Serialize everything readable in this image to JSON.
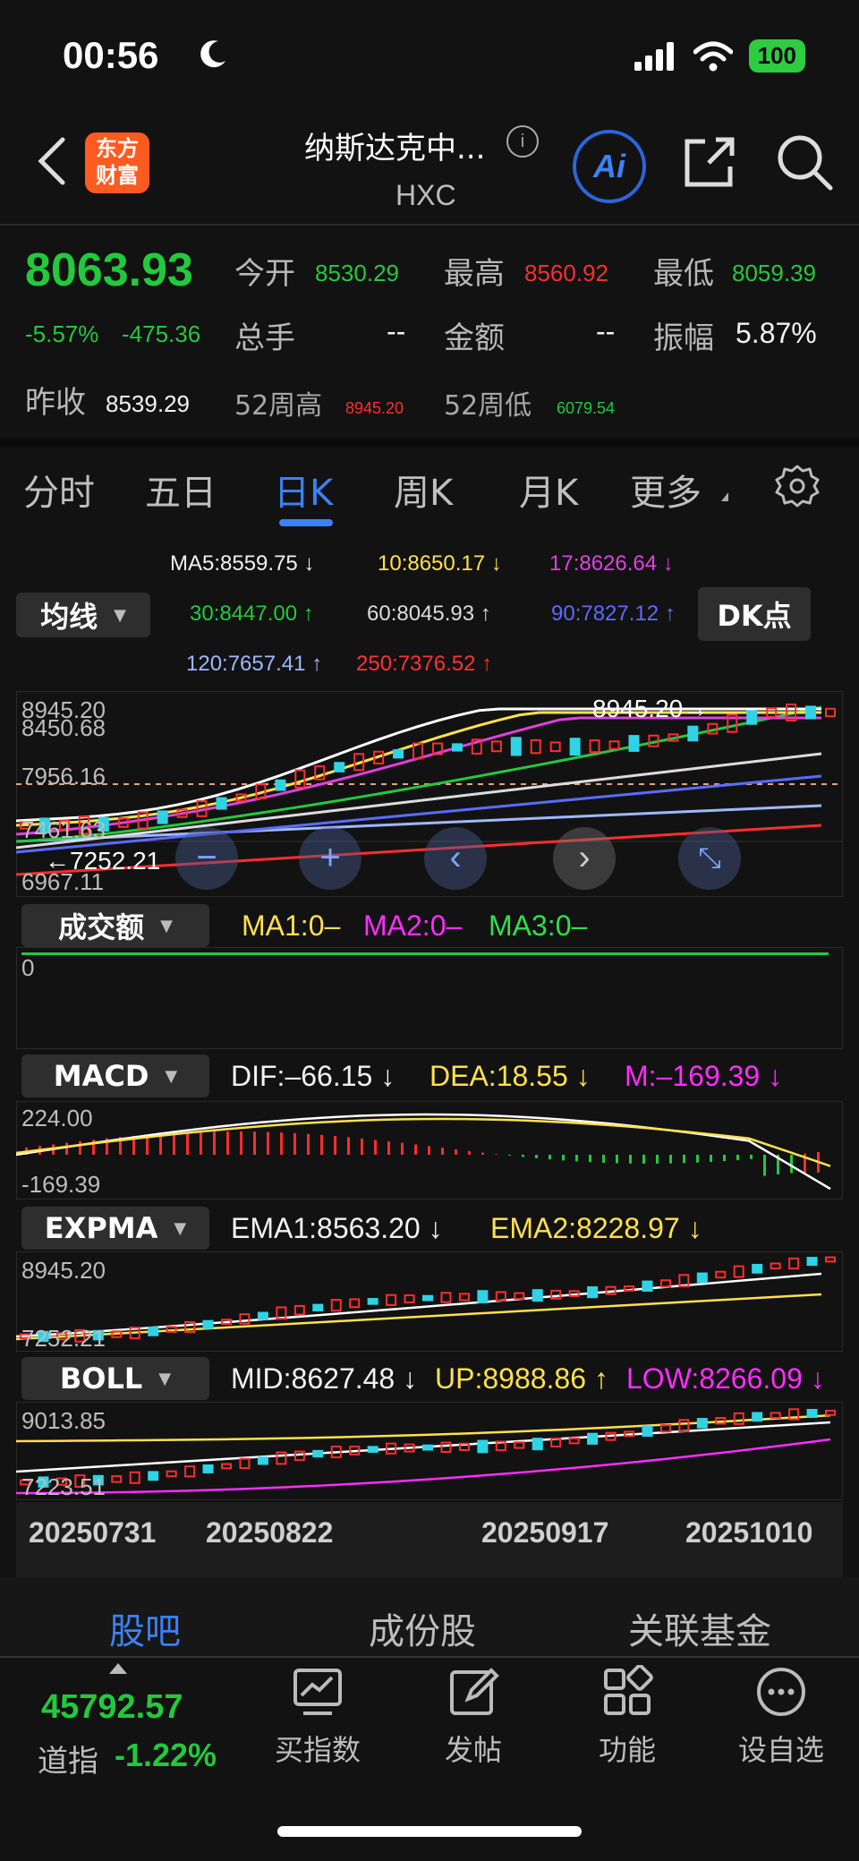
{
  "status": {
    "time": "00:56",
    "battery": "100"
  },
  "header": {
    "title": "纳斯达克中...",
    "code": "HXC",
    "logo_text": "东方\n财富",
    "ai_label": "Ai"
  },
  "quote": {
    "price": "8063.93",
    "change_pct": "-5.57%",
    "change": "-475.36",
    "open_label": "今开",
    "open": "8530.29",
    "high_label": "最高",
    "high": "8560.92",
    "low_label": "最低",
    "low": "8059.39",
    "volume_label": "总手",
    "volume": "--",
    "amount_label": "金额",
    "amount": "--",
    "amplitude_label": "振幅",
    "amplitude": "5.87%",
    "prev_label": "昨收",
    "prev": "8539.29",
    "w52h_label": "52周高",
    "w52h": "8945.20",
    "w52l_label": "52周低",
    "w52l": "6079.54"
  },
  "tabs": [
    "分时",
    "五日",
    "日K",
    "周K",
    "月K",
    "更多"
  ],
  "ma": {
    "selector": "均线",
    "dk": "DK点",
    "ma5": "MA5:8559.75 ↓",
    "ma10": "10:8650.17 ↓",
    "ma17": "17:8626.64 ↓",
    "ma30": "30:8447.00 ↑",
    "ma60": "60:8045.93 ↑",
    "ma90": "90:7827.12 ↑",
    "ma120": "120:7657.41 ↑",
    "ma250": "250:7376.52 ↑"
  },
  "main_chart": {
    "labels": [
      "8945.20",
      "8450.68",
      "7956.16",
      "7461.63",
      "6967.11"
    ],
    "max_label": "8945.20",
    "min_label": "7252.21"
  },
  "volume_panel": {
    "selector": "成交额",
    "ma1": "MA1:0–",
    "ma2": "MA2:0–",
    "ma3": "MA3:0–",
    "zero": "0"
  },
  "macd_panel": {
    "selector": "MACD",
    "dif": "DIF:–66.15 ↓",
    "dea": "DEA:18.55 ↓",
    "m": "M:–169.39 ↓",
    "top": "224.00",
    "bottom": "-169.39"
  },
  "expma_panel": {
    "selector": "EXPMA",
    "ema1": "EMA1:8563.20 ↓",
    "ema2": "EMA2:8228.97 ↓",
    "top": "8945.20",
    "bottom": "7252.21"
  },
  "boll_panel": {
    "selector": "BOLL",
    "mid": "MID:8627.48 ↓",
    "up": "UP:8988.86 ↑",
    "low": "LOW:8266.09 ↓",
    "top": "9013.85",
    "bottom": "7223.51"
  },
  "dates": [
    "20250731",
    "20250822",
    "20250917",
    "20251010"
  ],
  "bottom_tabs": [
    "股吧",
    "成份股",
    "关联基金"
  ],
  "bottom_nav": {
    "dow_value": "45792.57",
    "dow_label": "道指",
    "dow_change": "-1.22%",
    "items": [
      "买指数",
      "发帖",
      "功能",
      "设自选"
    ]
  },
  "colors": {
    "up": "#ff2d2d",
    "down": "#23c93d",
    "accent": "#3b82f6"
  }
}
